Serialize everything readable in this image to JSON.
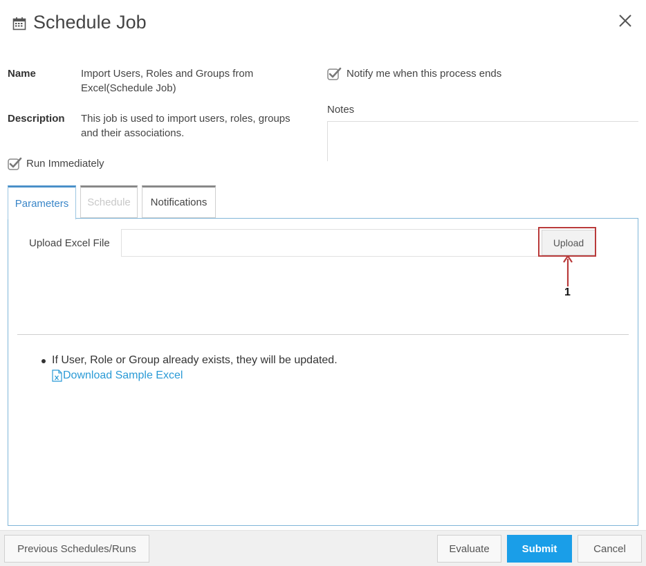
{
  "dialog": {
    "title": "Schedule Job",
    "title_icon": "calendar-icon",
    "close_icon": "close-icon"
  },
  "form": {
    "name_label": "Name",
    "name_value": "Import Users, Roles and Groups from Excel(Schedule Job)",
    "name_value_line1": "Import Users, Roles and Groups from",
    "name_value_line2": "Excel(Schedule Job)",
    "description_label": "Description",
    "description_value_line1": "This job is used to import users, roles, groups",
    "description_value_line2": "and their associations.",
    "run_immediately_label": "Run Immediately",
    "run_immediately_checked": true,
    "notify_label": "Notify me when this process ends",
    "notify_checked": true,
    "notes_label": "Notes",
    "notes_value": ""
  },
  "tabs": [
    {
      "label": "Parameters",
      "state": "active"
    },
    {
      "label": "Schedule",
      "state": "disabled"
    },
    {
      "label": "Notifications",
      "state": "normal"
    }
  ],
  "parameters": {
    "upload_label": "Upload Excel File",
    "upload_value": "",
    "upload_button": "Upload",
    "annotation_number": "1",
    "info_bullet": "If User, Role or Group already exists, they will be updated.",
    "download_link": "Download Sample Excel",
    "download_icon": "excel-file-icon"
  },
  "footer": {
    "previous_button": "Previous Schedules/Runs",
    "evaluate_button": "Evaluate",
    "submit_button": "Submit",
    "cancel_button": "Cancel"
  },
  "colors": {
    "accent": "#1a9ee8",
    "link": "#2a9ad6",
    "annotation": "#b93a3a"
  }
}
